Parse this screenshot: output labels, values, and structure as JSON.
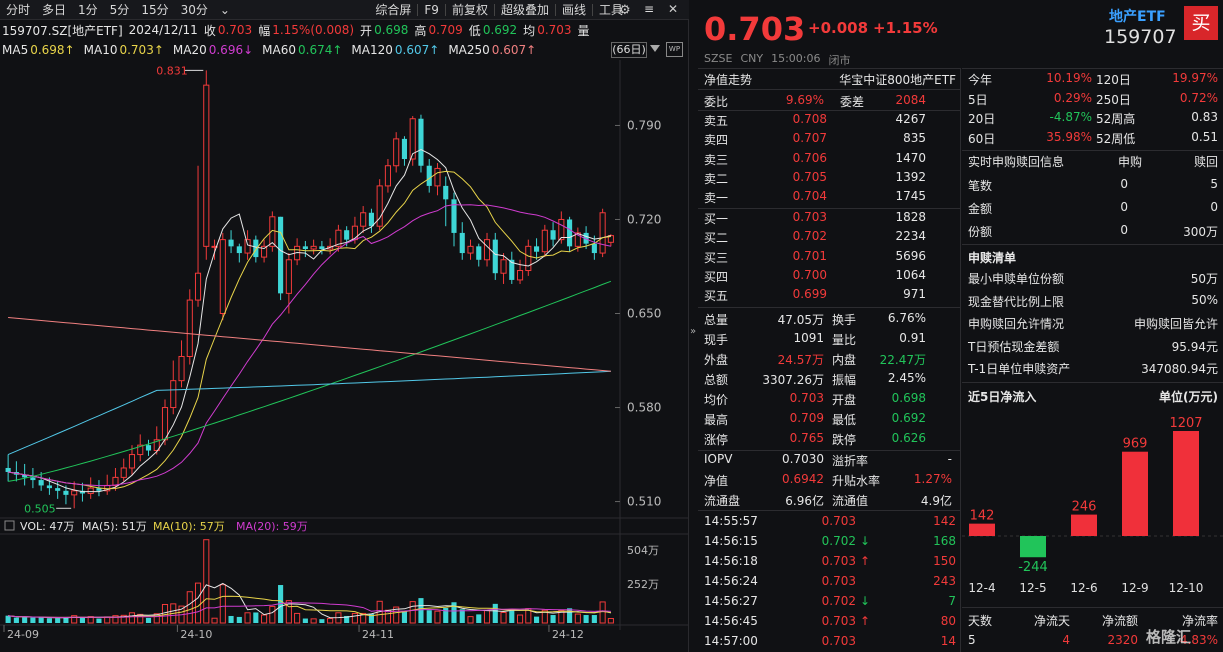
{
  "toolbar": {
    "tabs": [
      "分时",
      "多日",
      "1分",
      "5分",
      "15分",
      "30分"
    ],
    "more": "⌄",
    "right": [
      "综合屏",
      "F9",
      "前复权",
      "超级叠加",
      "画线",
      "工具"
    ],
    "side": "≡"
  },
  "quote": {
    "code": "159707.SZ[地产ETF]",
    "date": "2024/12/11",
    "close_label": "收",
    "close": "0.703",
    "amp_label": "幅",
    "amp": "1.15%(0.008)",
    "open_label": "开",
    "open": "0.698",
    "high_label": "高",
    "high": "0.709",
    "low_label": "低",
    "low": "0.692",
    "avg_label": "均",
    "avg": "0.703",
    "vol_label": "量"
  },
  "ma": {
    "items": [
      {
        "label": "MA5",
        "value": "0.698↑",
        "color": "#e6e6e6",
        "vcolor": "#e8d44a"
      },
      {
        "label": "MA10",
        "value": "0.703↑",
        "color": "#e6e6e6",
        "vcolor": "#e8d44a"
      },
      {
        "label": "MA20",
        "value": "0.696↓",
        "color": "#e6e6e6",
        "vcolor": "#d03cd0"
      },
      {
        "label": "MA60",
        "value": "0.674↑",
        "color": "#e6e6e6",
        "vcolor": "#21c45a"
      },
      {
        "label": "MA120",
        "value": "0.607↑",
        "color": "#e6e6e6",
        "vcolor": "#52c8e8"
      },
      {
        "label": "MA250",
        "value": "0.607↑",
        "color": "#e6e6e6",
        "vcolor": "#f08080"
      }
    ],
    "days": "(66日)",
    "wp": "WP"
  },
  "chart_data": {
    "type": "candlestick",
    "price_ticks": [
      "0.790",
      "0.720",
      "0.650",
      "0.580",
      "0.510"
    ],
    "max_label": "0.831",
    "min_label": "0.505",
    "x_ticks": [
      "24-09",
      "24-10",
      "24-11",
      "24-12"
    ],
    "vol_header": {
      "vol": "VOL: 47万",
      "ma5": "MA(5): 51万",
      "ma10": "MA(10): 57万",
      "ma20": "MA(20): 59万"
    },
    "vol_ticks": [
      "504万",
      "252万"
    ],
    "y_range": [
      0.5,
      0.835
    ],
    "candles": [
      [
        0.535,
        0.532,
        0.545,
        0.525
      ],
      [
        0.532,
        0.53,
        0.54,
        0.525
      ],
      [
        0.53,
        0.528,
        0.538,
        0.522
      ],
      [
        0.528,
        0.526,
        0.535,
        0.52
      ],
      [
        0.526,
        0.522,
        0.532,
        0.518
      ],
      [
        0.522,
        0.52,
        0.528,
        0.515
      ],
      [
        0.52,
        0.518,
        0.525,
        0.512
      ],
      [
        0.518,
        0.515,
        0.522,
        0.508
      ],
      [
        0.515,
        0.518,
        0.525,
        0.505
      ],
      [
        0.518,
        0.516,
        0.524,
        0.51
      ],
      [
        0.516,
        0.52,
        0.528,
        0.512
      ],
      [
        0.52,
        0.518,
        0.526,
        0.514
      ],
      [
        0.518,
        0.522,
        0.53,
        0.515
      ],
      [
        0.522,
        0.528,
        0.535,
        0.518
      ],
      [
        0.528,
        0.535,
        0.542,
        0.525
      ],
      [
        0.535,
        0.545,
        0.552,
        0.53
      ],
      [
        0.545,
        0.552,
        0.56,
        0.54
      ],
      [
        0.552,
        0.548,
        0.556,
        0.544
      ],
      [
        0.548,
        0.556,
        0.566,
        0.545
      ],
      [
        0.556,
        0.58,
        0.586,
        0.552
      ],
      [
        0.58,
        0.6,
        0.615,
        0.575
      ],
      [
        0.6,
        0.618,
        0.63,
        0.595
      ],
      [
        0.618,
        0.66,
        0.668,
        0.612
      ],
      [
        0.66,
        0.68,
        0.76,
        0.655
      ],
      [
        0.7,
        0.82,
        0.831,
        0.69
      ],
      [
        0.7,
        0.7,
        0.705,
        0.69
      ],
      [
        0.65,
        0.705,
        0.71,
        0.645
      ],
      [
        0.705,
        0.7,
        0.712,
        0.695
      ],
      [
        0.7,
        0.695,
        0.702,
        0.688
      ],
      [
        0.695,
        0.705,
        0.712,
        0.69
      ],
      [
        0.705,
        0.692,
        0.708,
        0.688
      ],
      [
        0.692,
        0.7,
        0.705,
        0.688
      ],
      [
        0.7,
        0.722,
        0.726,
        0.696
      ],
      [
        0.722,
        0.665,
        0.722,
        0.66
      ],
      [
        0.665,
        0.69,
        0.695,
        0.65
      ],
      [
        0.69,
        0.7,
        0.706,
        0.686
      ],
      [
        0.7,
        0.698,
        0.704,
        0.692
      ],
      [
        0.698,
        0.7,
        0.705,
        0.694
      ],
      [
        0.7,
        0.698,
        0.704,
        0.694
      ],
      [
        0.698,
        0.7,
        0.706,
        0.694
      ],
      [
        0.7,
        0.712,
        0.716,
        0.696
      ],
      [
        0.712,
        0.705,
        0.715,
        0.7
      ],
      [
        0.705,
        0.715,
        0.722,
        0.702
      ],
      [
        0.715,
        0.725,
        0.73,
        0.71
      ],
      [
        0.725,
        0.715,
        0.728,
        0.71
      ],
      [
        0.715,
        0.745,
        0.75,
        0.712
      ],
      [
        0.745,
        0.76,
        0.765,
        0.74
      ],
      [
        0.76,
        0.78,
        0.785,
        0.755
      ],
      [
        0.78,
        0.765,
        0.782,
        0.76
      ],
      [
        0.765,
        0.795,
        0.797,
        0.76
      ],
      [
        0.795,
        0.76,
        0.798,
        0.755
      ],
      [
        0.76,
        0.745,
        0.765,
        0.74
      ],
      [
        0.745,
        0.758,
        0.762,
        0.738
      ],
      [
        0.745,
        0.735,
        0.752,
        0.715
      ],
      [
        0.735,
        0.71,
        0.74,
        0.7
      ],
      [
        0.71,
        0.695,
        0.718,
        0.69
      ],
      [
        0.695,
        0.7,
        0.705,
        0.69
      ],
      [
        0.7,
        0.69,
        0.702,
        0.685
      ],
      [
        0.69,
        0.705,
        0.71,
        0.685
      ],
      [
        0.705,
        0.68,
        0.71,
        0.675
      ],
      [
        0.68,
        0.69,
        0.695,
        0.672
      ],
      [
        0.69,
        0.675,
        0.696,
        0.672
      ],
      [
        0.675,
        0.682,
        0.69,
        0.672
      ],
      [
        0.682,
        0.7,
        0.705,
        0.678
      ],
      [
        0.7,
        0.696,
        0.706,
        0.69
      ],
      [
        0.696,
        0.712,
        0.716,
        0.692
      ],
      [
        0.712,
        0.705,
        0.718,
        0.7
      ],
      [
        0.705,
        0.72,
        0.726,
        0.702
      ],
      [
        0.72,
        0.7,
        0.722,
        0.696
      ],
      [
        0.7,
        0.71,
        0.714,
        0.696
      ],
      [
        0.71,
        0.702,
        0.715,
        0.698
      ],
      [
        0.702,
        0.695,
        0.708,
        0.69
      ],
      [
        0.695,
        0.725,
        0.728,
        0.692
      ],
      [
        0.703,
        0.708,
        0.709,
        0.7
      ]
    ]
  },
  "header": {
    "price": "0.703",
    "change": "+0.008",
    "pct": "+1.15%",
    "name": "地产ETF",
    "code": "159707",
    "buy": "买",
    "sub": [
      "SZSE",
      "CNY",
      "15:00:06",
      "闭市"
    ]
  },
  "book": {
    "title_left": "净值走势",
    "title_right": "华宝中证800地产ETF",
    "ratio_label": "委比",
    "ratio": "9.69%",
    "diff_label": "委差",
    "diff": "2084",
    "sells": [
      [
        "卖五",
        "0.708",
        "4267"
      ],
      [
        "卖四",
        "0.707",
        "835"
      ],
      [
        "卖三",
        "0.706",
        "1470"
      ],
      [
        "卖二",
        "0.705",
        "1392"
      ],
      [
        "卖一",
        "0.704",
        "1745"
      ]
    ],
    "buys": [
      [
        "买一",
        "0.703",
        "1828"
      ],
      [
        "买二",
        "0.702",
        "2234"
      ],
      [
        "买三",
        "0.701",
        "5696"
      ],
      [
        "买四",
        "0.700",
        "1064"
      ],
      [
        "买五",
        "0.699",
        "971"
      ]
    ]
  },
  "stats": [
    [
      [
        "总量",
        "47.05万",
        "w"
      ],
      [
        "换手",
        "6.76%",
        "w"
      ]
    ],
    [
      [
        "现手",
        "1091",
        "w"
      ],
      [
        "量比",
        "0.91",
        "w"
      ]
    ],
    [
      [
        "外盘",
        "24.57万",
        "r"
      ],
      [
        "内盘",
        "22.47万",
        "g"
      ]
    ],
    [
      [
        "总额",
        "3307.26万",
        "w"
      ],
      [
        "振幅",
        "2.45%",
        "w"
      ]
    ],
    [
      [
        "均价",
        "0.703",
        "r"
      ],
      [
        "开盘",
        "0.698",
        "g"
      ]
    ],
    [
      [
        "最高",
        "0.709",
        "r"
      ],
      [
        "最低",
        "0.692",
        "g"
      ]
    ],
    [
      [
        "涨停",
        "0.765",
        "r"
      ],
      [
        "跌停",
        "0.626",
        "g"
      ]
    ]
  ],
  "iopv": [
    [
      [
        "IOPV",
        "0.7030",
        "w"
      ],
      [
        "溢折率",
        "-",
        "w"
      ]
    ],
    [
      [
        "净值",
        "0.6942",
        "r"
      ],
      [
        "升贴水率",
        "1.27%",
        "r"
      ]
    ],
    [
      [
        "流通盘",
        "6.96亿",
        "w"
      ],
      [
        "流通值",
        "4.9亿",
        "w"
      ]
    ]
  ],
  "ticks": [
    [
      "14:55:57",
      "0.703",
      "",
      "142",
      "r",
      "r"
    ],
    [
      "14:56:15",
      "0.702",
      "↓",
      "168",
      "g",
      "g"
    ],
    [
      "14:56:18",
      "0.703",
      "↑",
      "150",
      "r",
      "r"
    ],
    [
      "14:56:24",
      "0.703",
      "",
      "243",
      "r",
      "r"
    ],
    [
      "14:56:27",
      "0.702",
      "↓",
      "7",
      "r",
      "g"
    ],
    [
      "14:56:45",
      "0.703",
      "↑",
      "80",
      "r",
      "r"
    ],
    [
      "14:57:00",
      "0.703",
      "",
      "14",
      "r",
      "r"
    ]
  ],
  "perf": [
    [
      [
        "今年",
        "10.19%",
        "r"
      ],
      [
        "120日",
        "19.97%",
        "r"
      ]
    ],
    [
      [
        "5日",
        "0.29%",
        "r"
      ],
      [
        "250日",
        "0.72%",
        "r"
      ]
    ],
    [
      [
        "20日",
        "-4.87%",
        "g"
      ],
      [
        "52周高",
        "0.83",
        "w"
      ]
    ],
    [
      [
        "60日",
        "35.98%",
        "r"
      ],
      [
        "52周低",
        "0.51",
        "w"
      ]
    ]
  ],
  "subscribe": {
    "title": "实时申购赎回信息",
    "col1": "申购",
    "col2": "赎回",
    "rows": [
      [
        "笔数",
        "0",
        "5"
      ],
      [
        "金额",
        "0",
        "0"
      ],
      [
        "份额",
        "0",
        "300万"
      ]
    ]
  },
  "list": {
    "title": "申赎清单",
    "rows": [
      [
        "最小申赎单位份额",
        "50万"
      ],
      [
        "现金替代比例上限",
        "50%"
      ],
      [
        "申购赎回允许情况",
        "申购赎回皆允许"
      ],
      [
        "T日预估现金差额",
        "95.94元"
      ],
      [
        "T-1日单位申赎资产",
        "347080.94元"
      ]
    ]
  },
  "inflow": {
    "title": "近5日净流入",
    "unit": "单位(万元)",
    "bars": [
      {
        "date": "12-4",
        "value": 142
      },
      {
        "date": "12-5",
        "value": -244
      },
      {
        "date": "12-6",
        "value": 246
      },
      {
        "date": "12-9",
        "value": 969
      },
      {
        "date": "12-10",
        "value": 1207
      }
    ]
  },
  "summary": {
    "headers": [
      "天数",
      "净流天",
      "净流额",
      "净流率"
    ],
    "values": [
      "5",
      "4",
      "2320",
      "4.83%"
    ]
  },
  "watermark": "格隆汇"
}
